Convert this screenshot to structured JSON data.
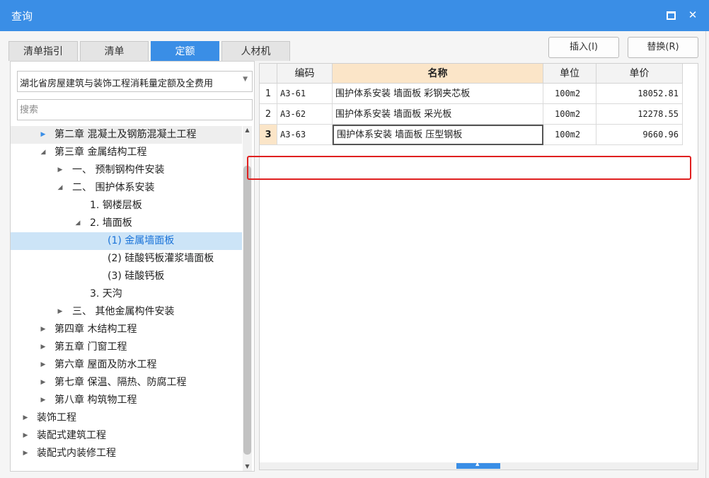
{
  "window": {
    "title": "查询"
  },
  "tabs": [
    "清单指引",
    "清单",
    "定额",
    "人材机"
  ],
  "active_tab": "定额",
  "actions": {
    "insert": "插入(I)",
    "replace": "替换(R)"
  },
  "library_select": {
    "value": "湖北省房屋建筑与装饰工程消耗量定额及全费用"
  },
  "search": {
    "placeholder": "搜索",
    "value": ""
  },
  "tree": [
    {
      "label": "第二章 混凝土及钢筋混凝土工程",
      "toggle": "▶",
      "state": "hover"
    },
    {
      "label": "第三章 金属结构工程",
      "toggle": "◢"
    },
    {
      "label": "一、 预制钢构件安装",
      "toggle": "▶"
    },
    {
      "label": "二、 围护体系安装",
      "toggle": "◢"
    },
    {
      "label": "1. 钢楼层板",
      "toggle": ""
    },
    {
      "label": "2. 墙面板",
      "toggle": "◢"
    },
    {
      "label": "(1) 金属墙面板",
      "toggle": "",
      "state": "selected"
    },
    {
      "label": "(2) 硅酸钙板灌浆墙面板",
      "toggle": ""
    },
    {
      "label": "(3) 硅酸钙板",
      "toggle": ""
    },
    {
      "label": "3. 天沟",
      "toggle": ""
    },
    {
      "label": "三、 其他金属构件安装",
      "toggle": "▶"
    },
    {
      "label": "第四章 木结构工程",
      "toggle": "▶"
    },
    {
      "label": "第五章 门窗工程",
      "toggle": "▶"
    },
    {
      "label": "第六章 屋面及防水工程",
      "toggle": "▶"
    },
    {
      "label": "第七章 保温、隔热、防腐工程",
      "toggle": "▶"
    },
    {
      "label": "第八章 构筑物工程",
      "toggle": "▶"
    },
    {
      "label": "装饰工程",
      "toggle": "▶"
    },
    {
      "label": "装配式建筑工程",
      "toggle": "▶"
    },
    {
      "label": "装配式内装修工程",
      "toggle": "▶"
    }
  ],
  "table": {
    "headers": {
      "code": "编码",
      "name": "名称",
      "unit": "单位",
      "price": "单价"
    },
    "rows": [
      {
        "no": "1",
        "code": "A3-61",
        "name": "围护体系安装 墙面板 彩钢夹芯板",
        "unit": "100m2",
        "price": "18052.81"
      },
      {
        "no": "2",
        "code": "A3-62",
        "name": "围护体系安装 墙面板 采光板",
        "unit": "100m2",
        "price": "12278.55"
      },
      {
        "no": "3",
        "code": "A3-63",
        "name": "围护体系安装 墙面板 压型钢板",
        "unit": "100m2",
        "price": "9660.96"
      }
    ],
    "current_row": 3
  },
  "icons": {
    "maximize": "maximize-icon",
    "close": "close-icon",
    "dropdown": "chevron-down-icon"
  },
  "colors": {
    "accent": "#3a8ee6",
    "highlight": "#e02020",
    "header_name": "#fbe5c8",
    "selected": "#cce4f7"
  }
}
